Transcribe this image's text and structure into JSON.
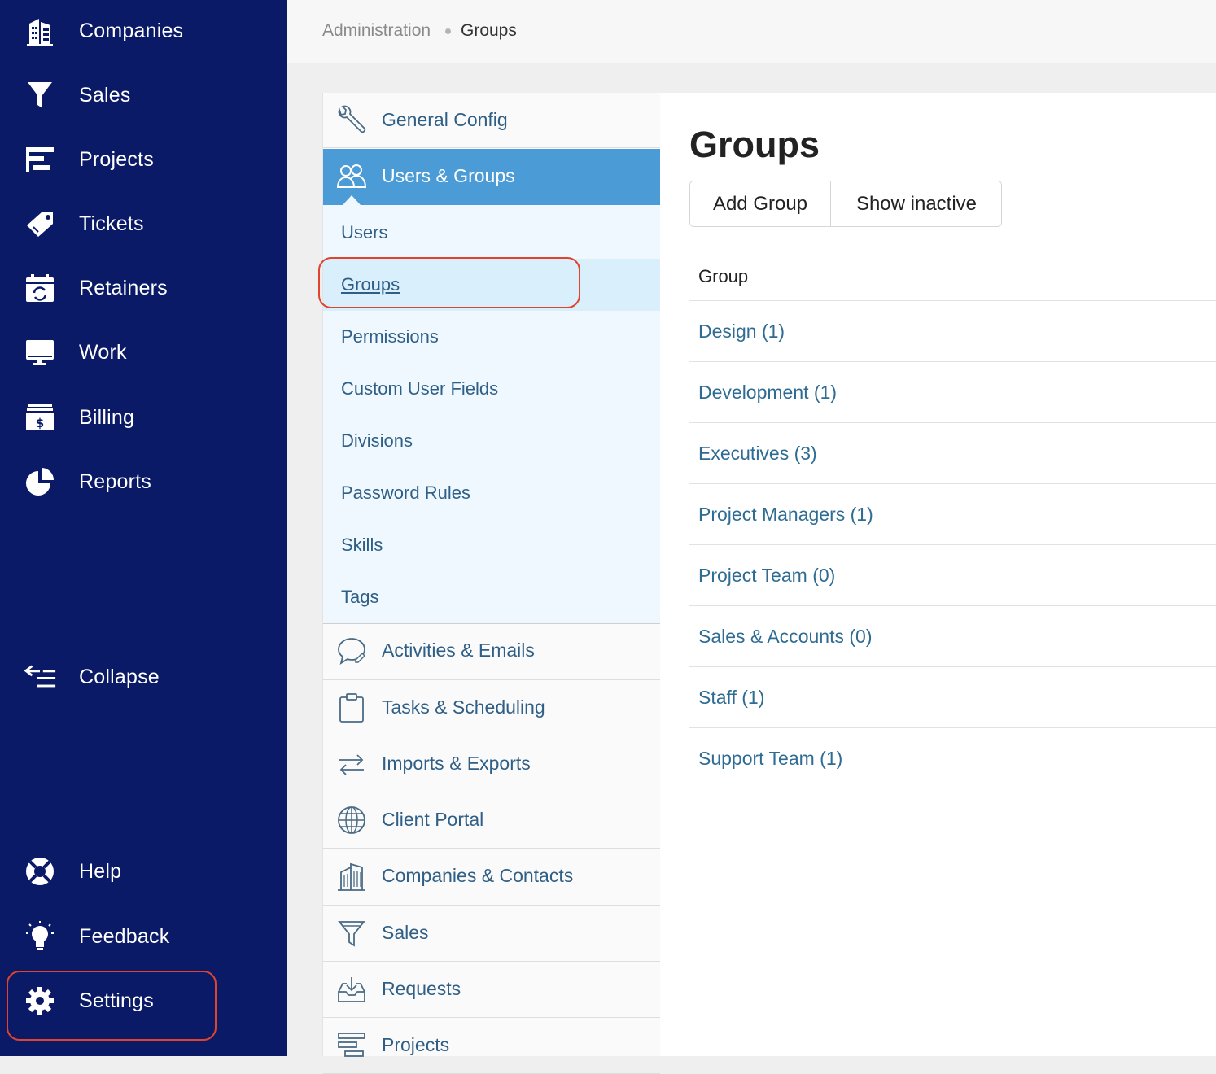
{
  "sidebar": {
    "items": [
      {
        "label": "Companies",
        "icon": "building-icon"
      },
      {
        "label": "Sales",
        "icon": "funnel-icon"
      },
      {
        "label": "Projects",
        "icon": "gantt-icon"
      },
      {
        "label": "Tickets",
        "icon": "ticket-tag-icon"
      },
      {
        "label": "Retainers",
        "icon": "calendar-refresh-icon"
      },
      {
        "label": "Work",
        "icon": "monitor-icon"
      },
      {
        "label": "Billing",
        "icon": "billing-icon"
      },
      {
        "label": "Reports",
        "icon": "pie-chart-icon"
      }
    ],
    "collapse_label": "Collapse",
    "help_label": "Help",
    "feedback_label": "Feedback",
    "settings_label": "Settings"
  },
  "breadcrumb": {
    "parent": "Administration",
    "current": "Groups"
  },
  "admin_menu": {
    "general_config": "General Config",
    "users_groups": "Users & Groups",
    "sub_items": [
      "Users",
      "Groups",
      "Permissions",
      "Custom User Fields",
      "Divisions",
      "Password Rules",
      "Skills",
      "Tags"
    ],
    "sections": [
      {
        "label": "Activities & Emails",
        "icon": "speech-bubble-icon"
      },
      {
        "label": "Tasks & Scheduling",
        "icon": "clipboard-icon"
      },
      {
        "label": "Imports & Exports",
        "icon": "arrows-exchange-icon"
      },
      {
        "label": "Client Portal",
        "icon": "globe-icon"
      },
      {
        "label": "Companies & Contacts",
        "icon": "building-icon"
      },
      {
        "label": "Sales",
        "icon": "funnel-icon"
      },
      {
        "label": "Requests",
        "icon": "inbox-icon"
      },
      {
        "label": "Projects",
        "icon": "gantt-icon"
      }
    ]
  },
  "main": {
    "title": "Groups",
    "add_group_label": "Add Group",
    "show_inactive_label": "Show inactive",
    "column_header": "Group",
    "groups": [
      "Design (1)",
      "Development (1)",
      "Executives (3)",
      "Project Managers (1)",
      "Project Team (0)",
      "Sales & Accounts (0)",
      "Staff (1)",
      "Support Team (1)"
    ]
  },
  "colors": {
    "sidebar_bg": "#0b1a66",
    "active_menu": "#4a9bd6",
    "link": "#2f6c93",
    "highlight": "#e0442f"
  }
}
